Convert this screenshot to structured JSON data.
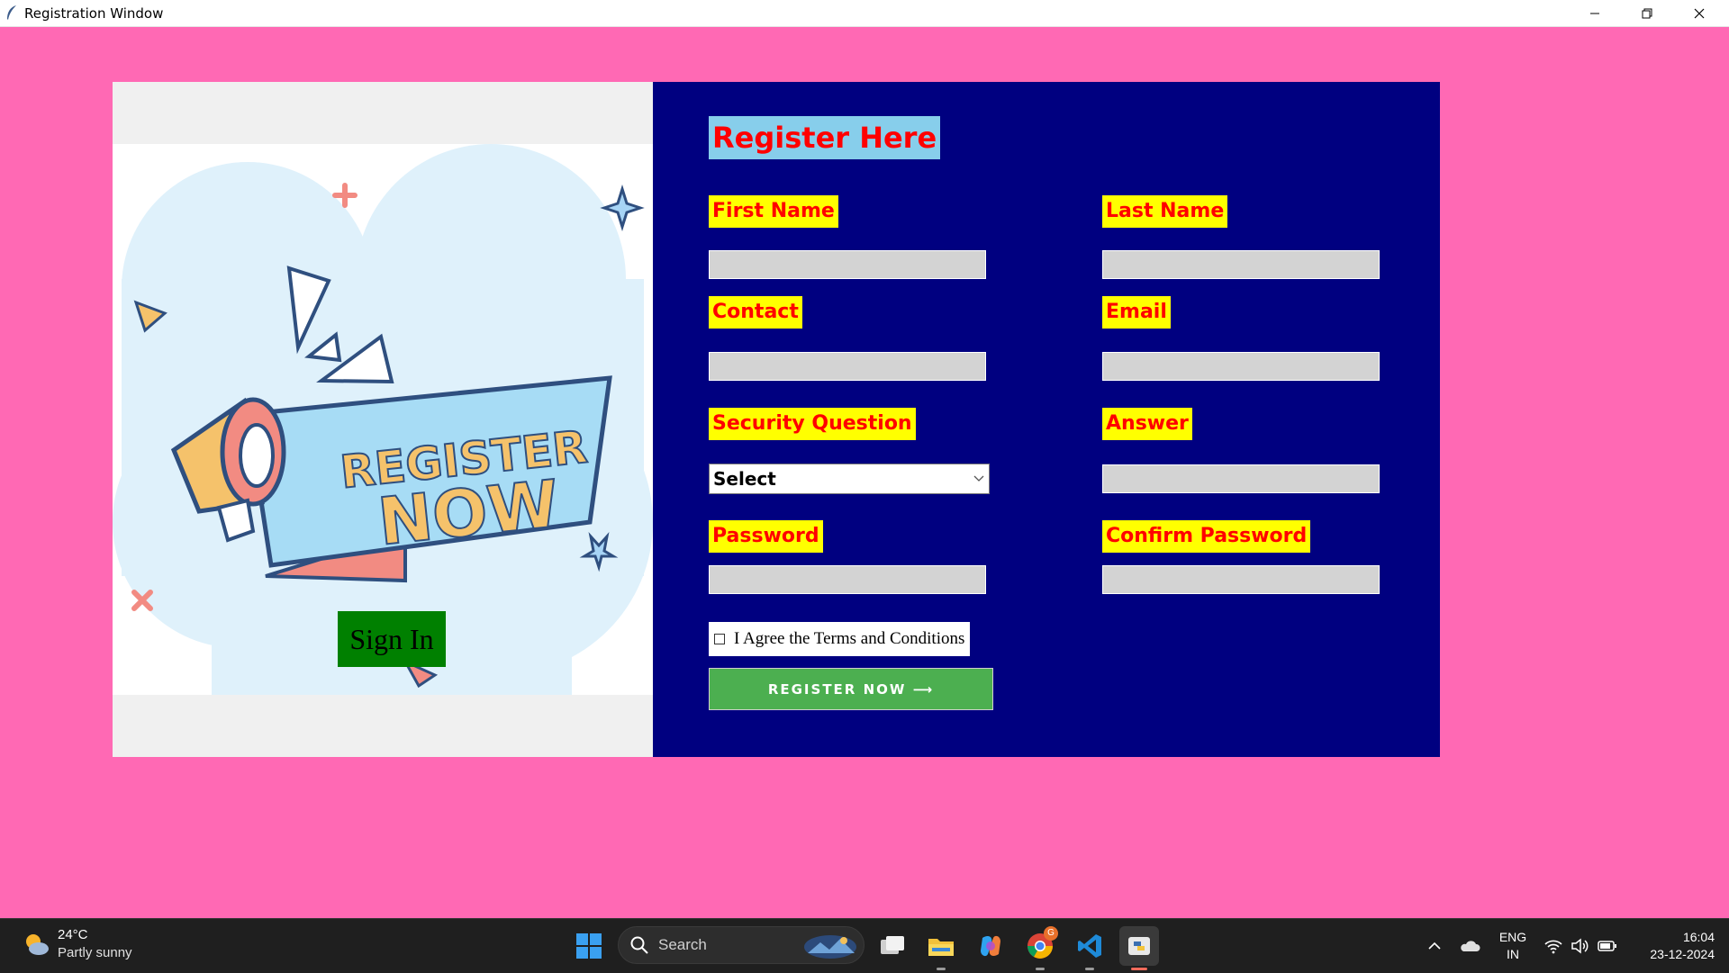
{
  "window": {
    "title": "Registration Window"
  },
  "left_panel": {
    "banner_line1": "REGISTER",
    "banner_line2": "NOW",
    "signin_label": "Sign In"
  },
  "form": {
    "heading": "Register Here",
    "first_name_label": "First Name",
    "last_name_label": "Last Name",
    "contact_label": "Contact",
    "email_label": "Email",
    "security_question_label": "Security Question",
    "security_question_value": "Select",
    "answer_label": "Answer",
    "password_label": "Password",
    "confirm_password_label": "Confirm Password",
    "terms_label": "I Agree the Terms and Conditions",
    "terms_checked": false,
    "register_button": "REGISTER NOW ⟶"
  },
  "taskbar": {
    "weather_temp": "24°C",
    "weather_condition": "Partly sunny",
    "search_placeholder": "Search",
    "lang_primary": "ENG",
    "lang_secondary": "IN",
    "time": "16:04",
    "date": "23-12-2024",
    "chrome_badge": "G"
  },
  "colors": {
    "background": "#ff69b4",
    "form_panel": "#000080",
    "label_bg": "#ffff00",
    "label_text": "#ff0000",
    "heading_bg": "#87ceeb",
    "register_button": "#4caf50",
    "signin_button": "#008000"
  }
}
